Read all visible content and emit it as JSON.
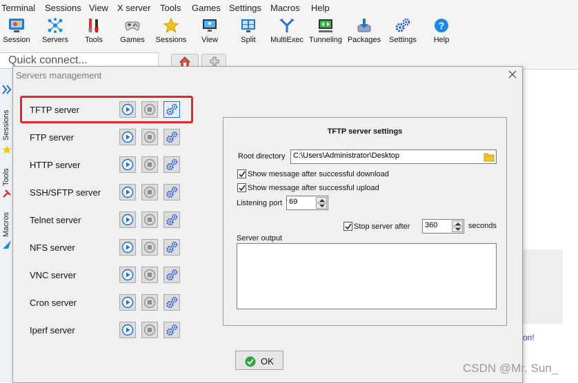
{
  "menu": [
    "Terminal",
    "Sessions",
    "View",
    "X server",
    "Tools",
    "Games",
    "Settings",
    "Macros",
    "Help"
  ],
  "toolbar": [
    {
      "label": "Session",
      "icon": "session-monitor-icon"
    },
    {
      "label": "Servers",
      "icon": "servers-network-icon"
    },
    {
      "label": "Tools",
      "icon": "tools-icon"
    },
    {
      "label": "Games",
      "icon": "gamepad-icon"
    },
    {
      "label": "Sessions",
      "icon": "sessions-star-icon"
    },
    {
      "label": "View",
      "icon": "view-monitor-icon"
    },
    {
      "label": "Split",
      "icon": "split-grid-icon"
    },
    {
      "label": "MultiExec",
      "icon": "multiexec-fork-icon"
    },
    {
      "label": "Tunneling",
      "icon": "tunneling-icon"
    },
    {
      "label": "Packages",
      "icon": "packages-download-icon"
    },
    {
      "label": "Settings",
      "icon": "settings-gears-icon"
    },
    {
      "label": "Help",
      "icon": "help-question-icon"
    }
  ],
  "quick_connect": {
    "placeholder": "Quick connect..."
  },
  "side_tabs": [
    "Sessions",
    "Tools",
    "Macros"
  ],
  "dialog": {
    "title": "Servers management",
    "servers": [
      "TFTP server",
      "FTP server",
      "HTTP server",
      "SSH/SFTP server",
      "Telnet server",
      "NFS server",
      "VNC server",
      "Cron server",
      "Iperf server"
    ],
    "selected_index": 0,
    "settings": {
      "title": "TFTP server settings",
      "root_dir_label": "Root directory",
      "root_dir_value": "C:\\Users\\Administrator\\Desktop",
      "show_download_label": "Show message after successful download",
      "show_download_checked": true,
      "show_upload_label": "Show message after successful upload",
      "show_upload_checked": true,
      "port_label": "Listening port",
      "port_value": "69",
      "stop_label": "Stop server after",
      "stop_checked": true,
      "stop_value": "360",
      "seconds_label": "seconds",
      "output_label": "Server output"
    },
    "ok_label": "OK"
  },
  "background": {
    "link_fragment": "on!",
    "watermark": "CSDN @Mr. Sun_"
  },
  "colors": {
    "selection_border": "#e3262a",
    "play_icon": "#1f6fc4",
    "gear_icon": "#2a5bd7",
    "ok_check": "#2aa63a",
    "folder": "#f2c230"
  }
}
